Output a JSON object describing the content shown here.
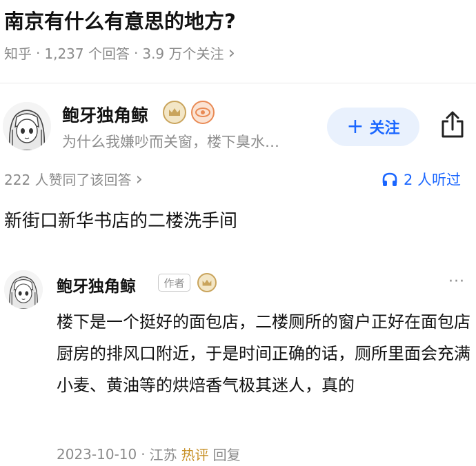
{
  "question": {
    "title": "南京有什么有意思的地方?",
    "meta": {
      "site": "知乎",
      "separator": "·",
      "answers": "1,237 个回答",
      "followers": "3.9 万个关注",
      "chevron": "›"
    }
  },
  "answer": {
    "author": {
      "name": "鲍牙独角鲸",
      "bio": "为什么我嫌吵而关窗，楼下臭水…",
      "avatar_icon": "anime-girl-avatar-icon",
      "badges": [
        "crown-badge-icon",
        "eye-badge-icon"
      ]
    },
    "follow_button": {
      "plus": "+",
      "label": "关注"
    },
    "share_icon": "share-icon",
    "upvotes": "222 人赞同了该回答",
    "upvotes_chevron": "›",
    "listen": {
      "icon": "headphones-icon",
      "label": "2 人听过"
    },
    "content": "新街口新华书店的二楼洗手间"
  },
  "comment": {
    "author": {
      "name": "鲍牙独角鲸",
      "tag": "作者",
      "badge": "crown-badge-icon"
    },
    "more": "···",
    "body": "楼下是一个挺好的面包店，二楼厕所的窗户正好在面包店厨房的排风口附近，于是时间正确的话，厕所里面会充满小麦、黄油等的烘焙香气极其迷人，真的",
    "date": "2023-10-10",
    "separator": "·",
    "location": "江苏",
    "hot_label": "热评",
    "reply_label": "回复"
  },
  "colors": {
    "accent": "#1a66ff",
    "follow_bg": "#e9f1fd",
    "muted_text": "#8a8a8a",
    "hot": "#c8922a",
    "crown_gold": "#c9a45c",
    "eye_orange": "#e98a54"
  }
}
